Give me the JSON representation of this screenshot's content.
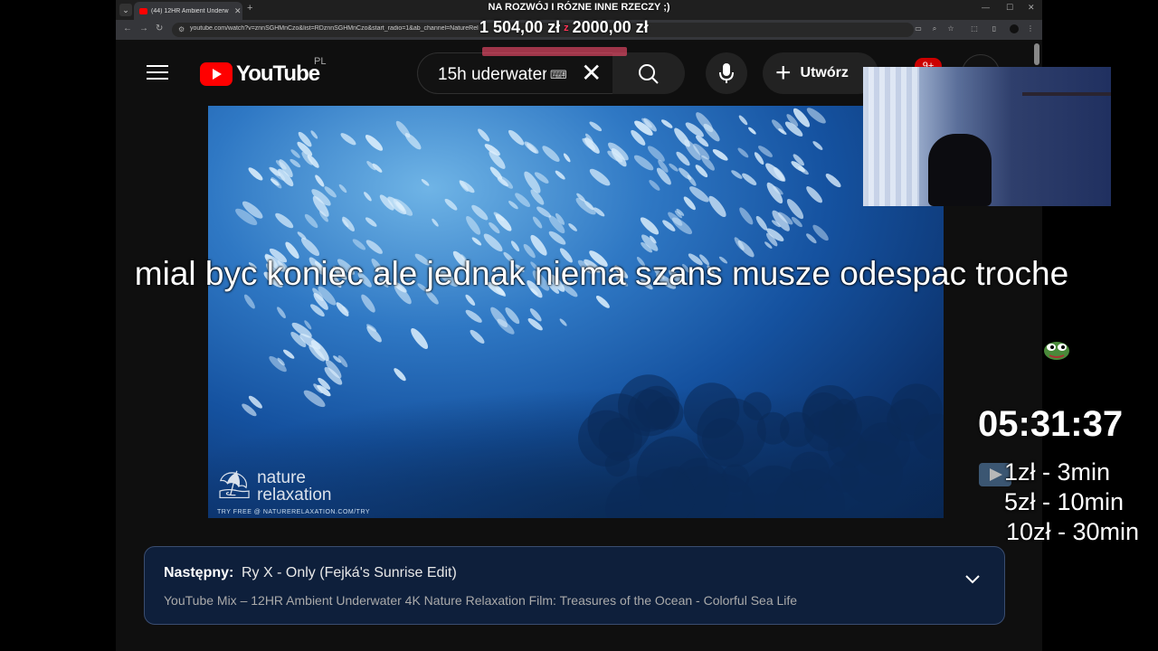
{
  "overlay": {
    "top_banner": "NA ROZWÓJ I RÓZNE INNE RZECZY ;)",
    "goal_current": "1 504,00 zł",
    "goal_separator": "z",
    "goal_target": "2000,00 zł",
    "caption": "mial byc koniec ale jednak niema szans musze odespac troche",
    "timer": "05:31:37",
    "rates": [
      "1zł - 3min",
      "5zł - 10min",
      "10zł - 30min"
    ]
  },
  "browser": {
    "tab_title": "(44) 12HR Ambient Underw",
    "url": "youtube.com/watch?v=znnSGHMnCzo&list=RDznnSGHMnCzo&start_radio=1&ab_channel=NatureRel"
  },
  "youtube": {
    "logo_text": "YouTube",
    "country": "PL",
    "search_value": "15h uderwater",
    "create_label": "Utwórz",
    "notifications": "9+"
  },
  "video": {
    "watermark_line1": "nature",
    "watermark_line2": "relaxation",
    "watermark_url": "TRY FREE @ NATURERELAXATION.COM/TRY"
  },
  "up_next": {
    "label": "Następny:",
    "song": "Ry X - Only (Fejká's Sunrise Edit)",
    "mix": "YouTube Mix – 12HR Ambient Underwater 4K Nature Relaxation Film: Treasures of the Ocean - Colorful Sea Life"
  },
  "colors": {
    "youtube_red": "#ff0000",
    "upnext_bg": "#0e1f3b",
    "goal_accent": "#ff3355"
  }
}
